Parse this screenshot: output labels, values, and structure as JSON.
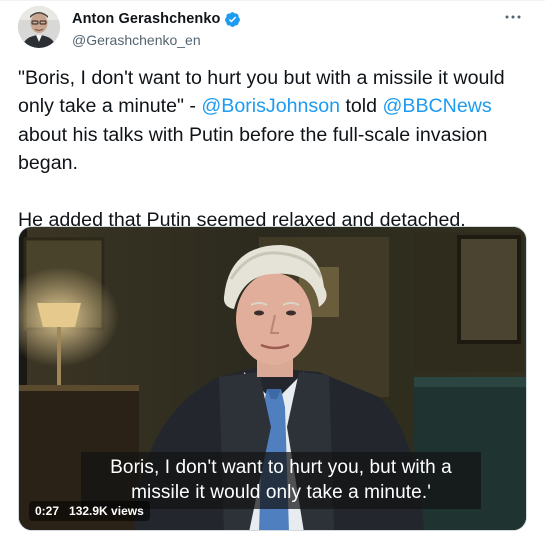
{
  "author": {
    "display_name": "Anton Gerashchenko",
    "handle": "@Gerashchenko_en",
    "verified": true,
    "avatar_icon": "avatar-photo"
  },
  "more_icon": "more-horizontal-icon",
  "tweet": {
    "text_1": "\"Boris, I don't want to hurt you but with a missile it would only take a minute\" - ",
    "mention_1": "@BorisJohnson",
    "text_2": " told ",
    "mention_2": "@BBCNews",
    "text_3": " about his talks with Putin before the full-scale invasion began.",
    "paragraph_2": "He added that Putin seemed relaxed and detached."
  },
  "video": {
    "subtitle": "Boris, I don't want to hurt you, but with a missile it would only take a minute.'",
    "duration": "0:27",
    "views": "132.9K views"
  },
  "colors": {
    "link": "#1d9bf0",
    "text": "#0f1419",
    "secondary": "#536471",
    "verified": "#1d9bf0"
  }
}
